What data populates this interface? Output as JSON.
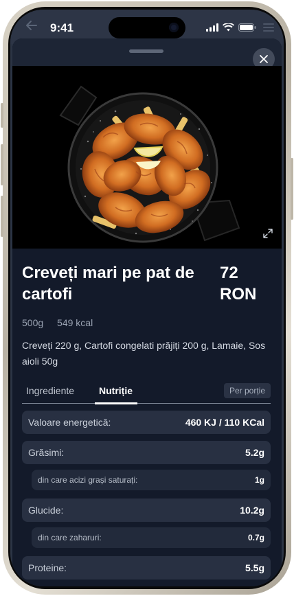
{
  "status_bar": {
    "time": "9:41"
  },
  "dish": {
    "title": "Creveți mari pe pat de cartofi",
    "price_amount": "72",
    "price_currency": "RON",
    "weight": "500g",
    "calories": "549 kcal",
    "description": "Creveți 220 g, Cartofi congelati prăjiți 200 g, Lamaie, Sos aioli 50g"
  },
  "tabs": {
    "ingredients": "Ingrediente",
    "nutrition": "Nutriție",
    "per_portion": "Per porție"
  },
  "nutrition": {
    "energy": {
      "label": "Valoare energetică:",
      "value": "460 KJ / 110 KCal"
    },
    "fat": {
      "label": "Grăsimi:",
      "value": "5.2g"
    },
    "sat_fat": {
      "label": "din care acizi grași saturați:",
      "value": "1g"
    },
    "carbs": {
      "label": "Glucide:",
      "value": "10.2g"
    },
    "sugars": {
      "label": "din care zaharuri:",
      "value": "0.7g"
    },
    "protein": {
      "label": "Proteine:",
      "value": "5.5g"
    }
  },
  "icons": [
    "back-arrow-icon",
    "signal-icon",
    "wifi-icon",
    "battery-icon",
    "close-icon",
    "expand-icon",
    "menu-icon"
  ]
}
